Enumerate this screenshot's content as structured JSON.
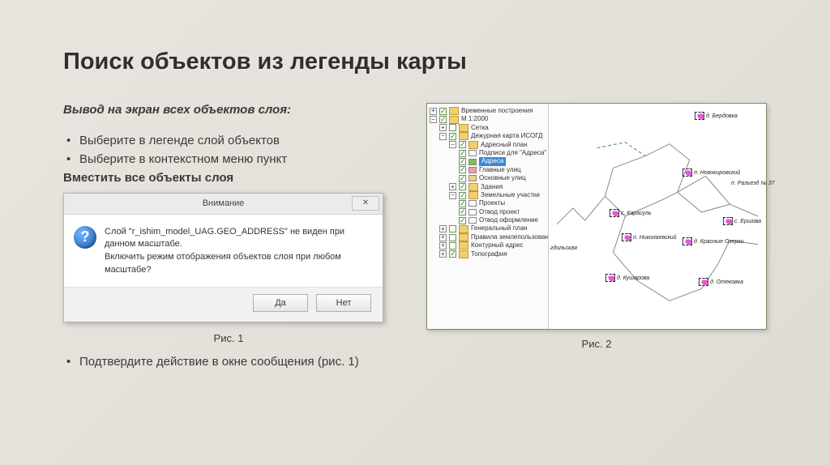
{
  "title": "Поиск объектов из легенды карты",
  "subtitle": "Вывод на экран всех объектов слоя:",
  "bullets": [
    "Выберите в легенде слой объектов",
    "Выберите в контекстном меню пункт"
  ],
  "bold_line": "Вместить все объекты слоя",
  "confirm_bullet": "Подтвердите действие в окне сообщения (рис. 1)",
  "fig1": "Рис. 1",
  "fig2": "Рис. 2",
  "dialog": {
    "title": "Внимание",
    "close": "✕",
    "icon": "?",
    "line1": "Слой \"r_ishim_model_UAG.GEO_ADDRESS\" не виден при данном масштабе.",
    "line2": "Включить режим отображения объектов слоя при любом масштабе?",
    "yes": "Да",
    "no": "Нет"
  },
  "tree": {
    "n0": "Временные построения",
    "n1": "М 1:2000",
    "n2": "Сетка",
    "n3": "Дежурная карта ИСОГД",
    "n4": "Адресный план",
    "n5": "Подписи для \"Адреса\"",
    "n6": "Адреса",
    "n7": "Главные улиц",
    "n8": "Основные улиц",
    "n9": "Здания",
    "n10": "Земельные участки",
    "n11": "Проекты",
    "n12": "Отвод проект",
    "n13": "Отвод оформление",
    "n14": "Генеральный план",
    "n15": "Правила землепользования и застройк",
    "n16": "Контурный адрес",
    "n17": "Топография"
  },
  "places": {
    "p1": "д. Бердовка",
    "p2": "п. Новокировский",
    "p3": "п. Разъезд № 37",
    "p4": "с. Карасуль",
    "p5": "с. Ершова",
    "p6": "п. Николаевский",
    "p7": "д. Красные Озерки",
    "p8": "д. Кушарова",
    "p9": "д. Отековка",
    "p10": "гдольская"
  }
}
